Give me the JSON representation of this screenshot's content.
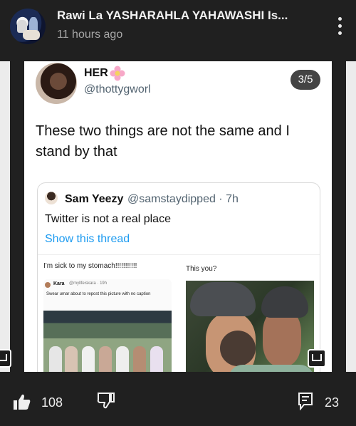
{
  "header": {
    "title": "Rawi La YASHARAHLA YAHAWASHI Is...",
    "time": "11 hours ago",
    "avatar_icon": "channel-avatar-icon",
    "more_icon": "more-vertical-icon"
  },
  "post": {
    "pager": "3/5",
    "tweet": {
      "name": "HER",
      "handle": "@thottygworl",
      "text": "These two things are not the same and I stand by that"
    },
    "quote": {
      "name": "Sam Yeezy",
      "handle": "@samstaydipped · 7h",
      "text": "Twitter is not a real place",
      "link": "Show this thread",
      "meme": {
        "left_caption": "I'm sick to my stomach!!!!!!!!!!!",
        "right_caption": "This you?",
        "inner_name": "Kara",
        "inner_handle": "@myllfeiskara · 19h",
        "inner_text": "Swear umar about to repost this picture with no caption"
      }
    }
  },
  "actions": {
    "likes": "108",
    "comments": "23",
    "like_icon": "thumbs-up-icon",
    "dislike_icon": "thumbs-down-icon",
    "comment_icon": "comment-icon"
  },
  "colors": {
    "background": "#202020",
    "link": "#1d9bf0",
    "handle": "#536471"
  }
}
